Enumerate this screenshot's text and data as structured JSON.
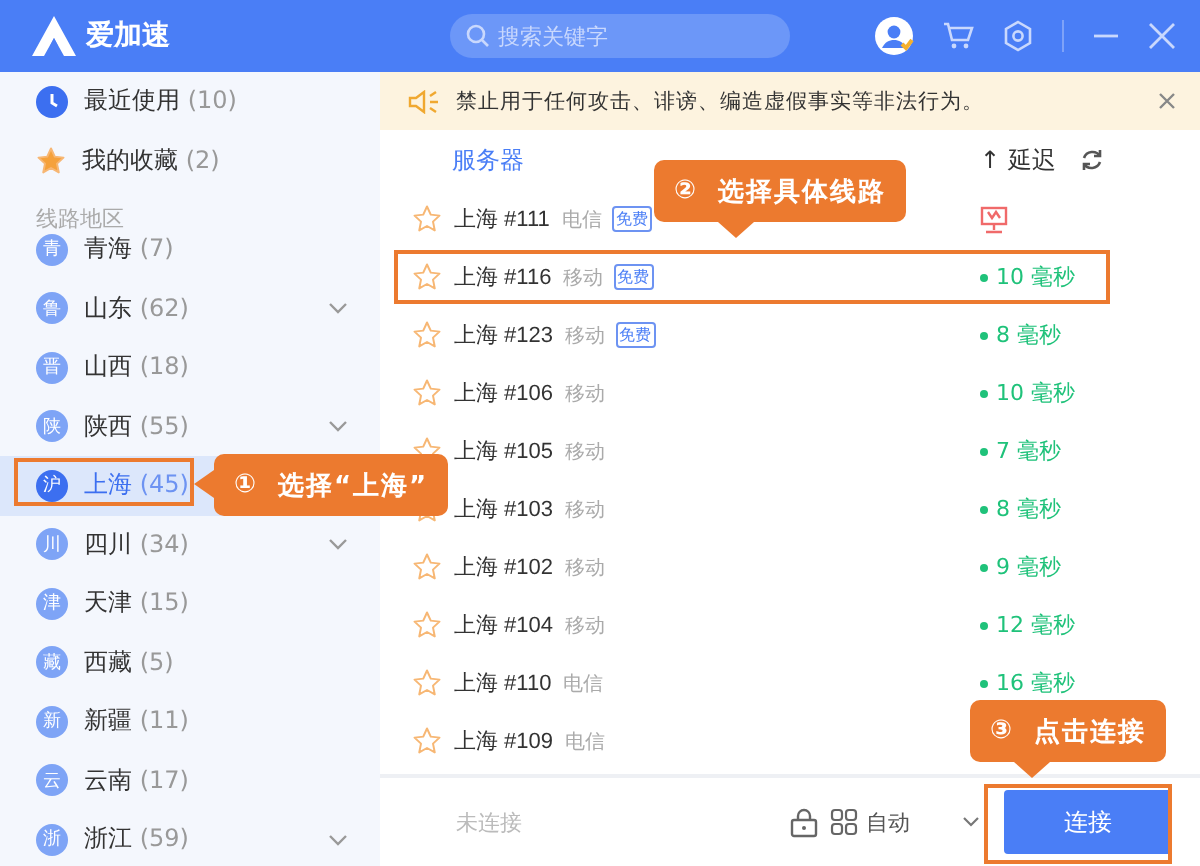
{
  "header": {
    "app_name": "爱加速",
    "search": {
      "placeholder": "搜索关键字"
    }
  },
  "sidebar": {
    "items": [
      {
        "kind": "recent",
        "label": "最近使用",
        "count": "(10)"
      },
      {
        "kind": "favorites",
        "label": "我的收藏",
        "count": "(2)"
      }
    ],
    "section_title": "线路地区",
    "regions": [
      {
        "badge": "青",
        "label": "青海",
        "count": "(7)",
        "expandable": false,
        "selected": false
      },
      {
        "badge": "鲁",
        "label": "山东",
        "count": "(62)",
        "expandable": true,
        "selected": false
      },
      {
        "badge": "晋",
        "label": "山西",
        "count": "(18)",
        "expandable": false,
        "selected": false
      },
      {
        "badge": "陕",
        "label": "陕西",
        "count": "(55)",
        "expandable": true,
        "selected": false
      },
      {
        "badge": "沪",
        "label": "上海",
        "count": "(45)",
        "expandable": false,
        "selected": true
      },
      {
        "badge": "川",
        "label": "四川",
        "count": "(34)",
        "expandable": true,
        "selected": false
      },
      {
        "badge": "津",
        "label": "天津",
        "count": "(15)",
        "expandable": false,
        "selected": false
      },
      {
        "badge": "藏",
        "label": "西藏",
        "count": "(5)",
        "expandable": false,
        "selected": false
      },
      {
        "badge": "新",
        "label": "新疆",
        "count": "(11)",
        "expandable": false,
        "selected": false
      },
      {
        "badge": "云",
        "label": "云南",
        "count": "(17)",
        "expandable": false,
        "selected": false
      },
      {
        "badge": "浙",
        "label": "浙江",
        "count": "(59)",
        "expandable": true,
        "selected": false
      }
    ]
  },
  "notice": {
    "text": "禁止用于任何攻击、诽谤、编造虚假事实等非法行为。"
  },
  "server_list": {
    "columns": {
      "server": "服务器",
      "sort_arrow": "↑",
      "latency": "延迟"
    },
    "rows": [
      {
        "name": "上海 #111",
        "carrier": "电信",
        "free_badge": "免费",
        "kind": "unavailable"
      },
      {
        "name": "上海 #116",
        "carrier": "移动",
        "free_badge": "免费",
        "kind": "ping",
        "latency": "10 毫秒"
      },
      {
        "name": "上海 #123",
        "carrier": "移动",
        "free_badge": "免费",
        "kind": "ping",
        "latency": "8 毫秒"
      },
      {
        "name": "上海 #106",
        "carrier": "移动",
        "kind": "ping",
        "latency": "10 毫秒"
      },
      {
        "name": "上海 #105",
        "carrier": "移动",
        "kind": "ping",
        "latency": "7 毫秒"
      },
      {
        "name": "上海 #103",
        "carrier": "移动",
        "kind": "ping",
        "latency": "8 毫秒"
      },
      {
        "name": "上海 #102",
        "carrier": "移动",
        "kind": "ping",
        "latency": "9 毫秒"
      },
      {
        "name": "上海 #104",
        "carrier": "移动",
        "kind": "ping",
        "latency": "12 毫秒"
      },
      {
        "name": "上海 #110",
        "carrier": "电信",
        "kind": "ping",
        "latency": "16 毫秒"
      },
      {
        "name": "上海 #109",
        "carrier": "电信",
        "kind": "hidden"
      }
    ]
  },
  "bottom_bar": {
    "status": "未连接",
    "mode": "自动",
    "connect_button": "连接"
  },
  "annotations": [
    {
      "kind": "region",
      "number": "①",
      "text": "选择“上海”"
    },
    {
      "kind": "server",
      "number": "②",
      "text": "选择具体线路"
    },
    {
      "kind": "connect",
      "number": "③",
      "text": "点击连接"
    }
  ]
}
